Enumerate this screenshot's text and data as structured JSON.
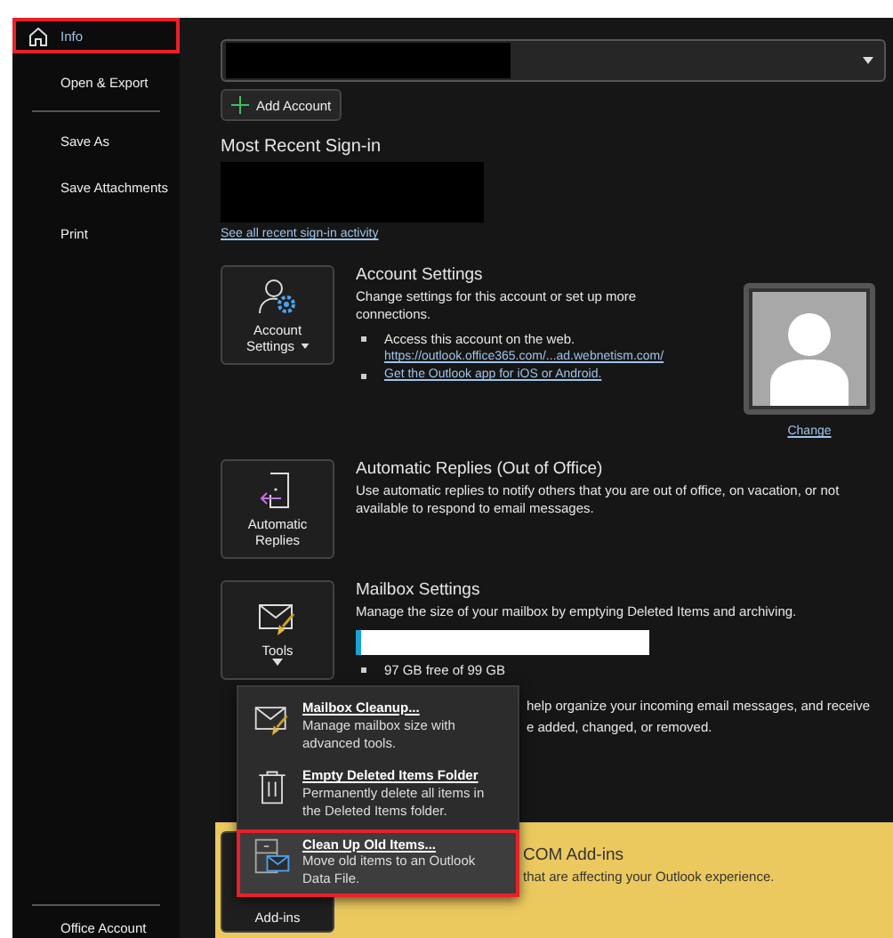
{
  "sidebar": {
    "top_items": [
      {
        "label": "Info",
        "selected": true,
        "highlighted": true
      },
      {
        "label": "Open & Export",
        "selected": false,
        "highlighted": false
      }
    ],
    "items": [
      {
        "label": "Save As",
        "selected": false,
        "highlighted": false
      },
      {
        "label": "Save Attachments",
        "selected": false,
        "highlighted": false
      },
      {
        "label": "Print",
        "selected": false,
        "highlighted": false
      }
    ],
    "footer_items": [
      {
        "label": "Office Account",
        "selected": false,
        "highlighted": false
      }
    ]
  },
  "add_account_button": "Add Account",
  "recent_signin": {
    "title": "Most Recent Sign-in",
    "link": "See all recent sign-in activity"
  },
  "sections": [
    {
      "kind": "account",
      "button_lines": [
        "Account",
        "Settings"
      ],
      "has_caret": true,
      "title": "Account Settings",
      "description": "Change settings for this account or set up more connections.",
      "bullets": [
        {
          "text": "Access this account on the web.",
          "link": "https://outlook.office365.com/...ad.webnetism.com/"
        },
        {
          "link": "Get the Outlook app for iOS or Android."
        }
      ],
      "profile_link": "Change"
    },
    {
      "kind": "replies",
      "button_lines": [
        "Automatic",
        "Replies"
      ],
      "title": "Automatic Replies (Out of Office)",
      "description": "Use automatic replies to notify others that you are out of office, on vacation, or not available to respond to email messages."
    },
    {
      "kind": "tools",
      "button_lines": [
        "Tools"
      ],
      "has_caret": true,
      "title": "Mailbox Settings",
      "description": "Manage the size of your mailbox by emptying Deleted Items and archiving.",
      "storage": {
        "level": 0.02,
        "reading": "97 GB free of 99 GB"
      }
    },
    {
      "kind": "hidden",
      "lines": [
        "help organize your incoming email messages, and receive",
        "e added, changed, or removed."
      ]
    },
    {
      "kind": "addins",
      "button_lines": [
        "Add-ins"
      ],
      "title": "COM Add-ins",
      "description": "that are affecting your Outlook experience."
    }
  ],
  "tools_menu": [
    {
      "kind": "cleanup",
      "title": "Mailbox Cleanup...",
      "description": "Manage mailbox size with advanced tools.",
      "selected": false,
      "highlighted": false
    },
    {
      "kind": "empty",
      "title": "Empty Deleted Items Folder",
      "description": "Permanently delete all items in the Deleted Items folder.",
      "selected": false,
      "highlighted": false
    },
    {
      "kind": "archive",
      "title": "Clean Up Old Items...",
      "description": "Move old items to an Outlook Data File.",
      "selected": true,
      "highlighted": true
    }
  ]
}
